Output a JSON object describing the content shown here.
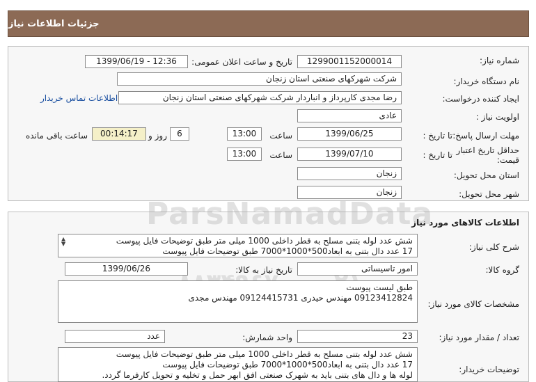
{
  "header": {
    "title": "جزئیات اطلاعات نیاز"
  },
  "need": {
    "need_number_label": "شماره نیاز:",
    "need_number": "1299001152000014",
    "announce_label": "تاریخ و ساعت اعلان عمومی:",
    "announce_value": "1399/06/19 - 12:36",
    "buyer_org_label": "نام دستگاه خریدار:",
    "buyer_org": "شرکت شهرکهای صنعتی استان زنجان",
    "creator_label": "ایجاد کننده درخواست:",
    "creator": "رضا مجدی کارپرداز و انباردار شرکت شهرکهای صنعتی استان زنجان",
    "contact_link": "اطلاعات تماس خریدار",
    "priority_label": "اولویت نیاز :",
    "priority": "عادی",
    "deadline_label": "مهلت ارسال پاسخ:",
    "until_date_label": "تا تاریخ :",
    "deadline_date": "1399/06/25",
    "time_label": "ساعت",
    "deadline_time": "13:00",
    "days_value": "6",
    "days_label": "روز و",
    "remaining_time": "00:14:17",
    "remaining_label": "ساعت باقی مانده",
    "validity_label": "حداقل تاریخ اعتبار قیمت:",
    "validity_until_label": "تا تاریخ :",
    "validity_date": "1399/07/10",
    "validity_time_label": "ساعت",
    "validity_time": "13:00",
    "province_label": "استان محل تحویل:",
    "province": "زنجان",
    "city_label": "شهر محل تحویل:",
    "city": "زنجان"
  },
  "goods": {
    "section_title": "اطلاعات کالاهای مورد نیاز",
    "summary_label": "شرح کلی نیاز:",
    "summary_lines": [
      "شش عدد لوله بتنی مسلح به قطر داخلی 1000 میلی متر طبق توضیحات فایل پیوست",
      "17 عدد دال بتنی به ابعاد500*1000*7000 طبق توضیحات فایل پیوست"
    ],
    "group_label": "گروه کالا:",
    "group": "امور تاسیساتی",
    "need_date_label": "تاریخ نیاز به کالا:",
    "need_date": "1399/06/26",
    "specs_label": "مشخصات کالای مورد نیاز:",
    "specs_lines": [
      "طبق لیست پیوست",
      "09123412824 مهندس حیدری     09124415731 مهندس مجدی"
    ],
    "qty_label": "تعداد / مقدار مورد نیاز:",
    "qty": "23",
    "unit_label": "واحد شمارش:",
    "unit": "عدد",
    "buyer_notes_label": "توضیحات خریدار:",
    "buyer_notes_lines": [
      "شش عدد لوله بتنی مسلح به قطر داخلی 1000 میلی متر طبق توضیحات فایل پیوست",
      "17 عدد دال بتنی به ابعاد500*1000*7000 طبق توضیحات فایل پیوست",
      "لوله ها و دال های بتنی باید به شهرک صنعتی افق ابهر حمل و تخلیه و تحویل کارفرما گردد."
    ]
  },
  "watermark": {
    "text": "ParsNamadData",
    "phone": "۰۲۱ - ۸۸۳۴۹۶۷۰"
  },
  "colors": {
    "header_bg": "#8c6a55",
    "link": "#1a4fa0",
    "timer_bg": "#f5f0c8"
  }
}
